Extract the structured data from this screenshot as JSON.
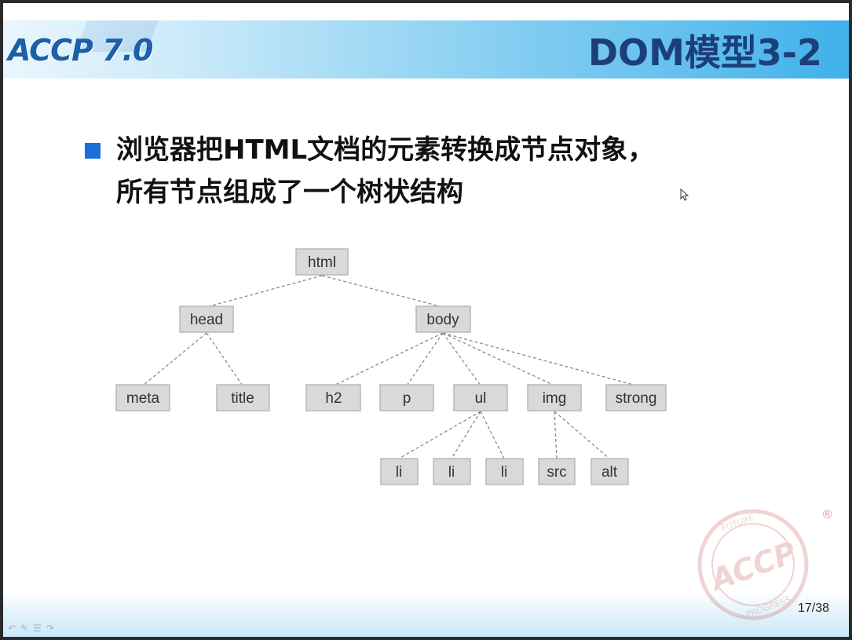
{
  "header": {
    "logo": "ACCP 7.0",
    "title": "DOM模型3-2"
  },
  "bullet": {
    "line1": "浏览器把HTML文档的元素转换成节点对象，",
    "line2": "所有节点组成了一个树状结构"
  },
  "tree": {
    "root": "html",
    "head": "head",
    "body": "body",
    "meta": "meta",
    "title": "title",
    "h2": "h2",
    "p": "p",
    "ul": "ul",
    "img": "img",
    "strong": "strong",
    "li1": "li",
    "li2": "li",
    "li3": "li",
    "src": "src",
    "alt": "alt"
  },
  "footer": {
    "page_number": "17/38",
    "stamp_text": "ACCP",
    "stamp_ring_top": "FUTURE",
    "stamp_ring_bottom": "PROGRESS",
    "registered_mark": "®"
  },
  "nav": {
    "prev_icon": "arrow-back-icon",
    "pen_icon": "pen-icon",
    "menu_icon": "menu-icon",
    "next_icon": "arrow-forward-icon"
  },
  "colors": {
    "accent": "#1a6ed8",
    "title": "#1c3f7a",
    "node_fill": "#d9d9d9"
  }
}
